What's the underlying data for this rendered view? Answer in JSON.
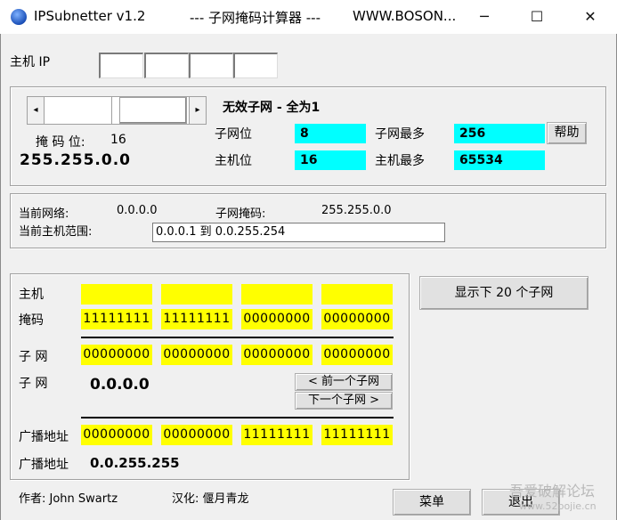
{
  "window": {
    "app_title": "IPSubnetter v1.2",
    "subtitle": "--- 子网掩码计算器 ---",
    "url": "WWW.BOSON...",
    "minimize": "─",
    "maximize": "☐",
    "close": "✕"
  },
  "host_ip": {
    "label": "主机 IP",
    "octets": [
      "",
      "",
      "",
      ""
    ]
  },
  "mask": {
    "left_arrow": "◂",
    "right_arrow": "▸",
    "slider_value_fraction": 0.5,
    "bits_label": "掩 码 位:",
    "bits_value": "16",
    "mask_value": "255.255.0.0",
    "warning": "无效子网 - 全为1",
    "subnet_bits_label": "子网位",
    "subnet_bits_value": "8",
    "max_subnets_label": "子网最多",
    "max_subnets_value": "256",
    "host_bits_label": "主机位",
    "host_bits_value": "16",
    "max_hosts_label": "主机最多",
    "max_hosts_value": "65534",
    "help_button": "帮助"
  },
  "current": {
    "network_label": "当前网络:",
    "network_value": "0.0.0.0",
    "subnet_mask_label": "子网掩码:",
    "subnet_mask_value": "255.255.0.0",
    "host_range_label": "当前主机范围:",
    "host_range_value": "0.0.0.1  到  0.0.255.254"
  },
  "binary": {
    "host_label": "主机",
    "host_bits": [
      "",
      "",
      "",
      ""
    ],
    "mask_label": "掩码",
    "mask_bits": [
      "11111111",
      "11111111",
      "00000000",
      "00000000"
    ],
    "subnet_label": "子 网",
    "subnet_bits": [
      "00000000",
      "00000000",
      "00000000",
      "00000000"
    ],
    "subnet_label2": "子 网",
    "subnet_value": "0.0.0.0",
    "prev_subnet_button": "< 前一个子网",
    "next_subnet_button": "下一个子网 >",
    "broadcast_label": "广播地址",
    "broadcast_bits": [
      "00000000",
      "00000000",
      "11111111",
      "11111111"
    ],
    "broadcast_label2": "广播地址",
    "broadcast_value": "0.0.255.255"
  },
  "show_subnets_button": "显示下 20 个子网",
  "footer": {
    "author": "作者: John Swartz",
    "translator": "汉化: 偃月青龙",
    "menu_button": "菜单",
    "exit_button": "退出"
  },
  "watermark": {
    "text": "吾爱破解论坛",
    "url": "www.52pojie.cn"
  }
}
